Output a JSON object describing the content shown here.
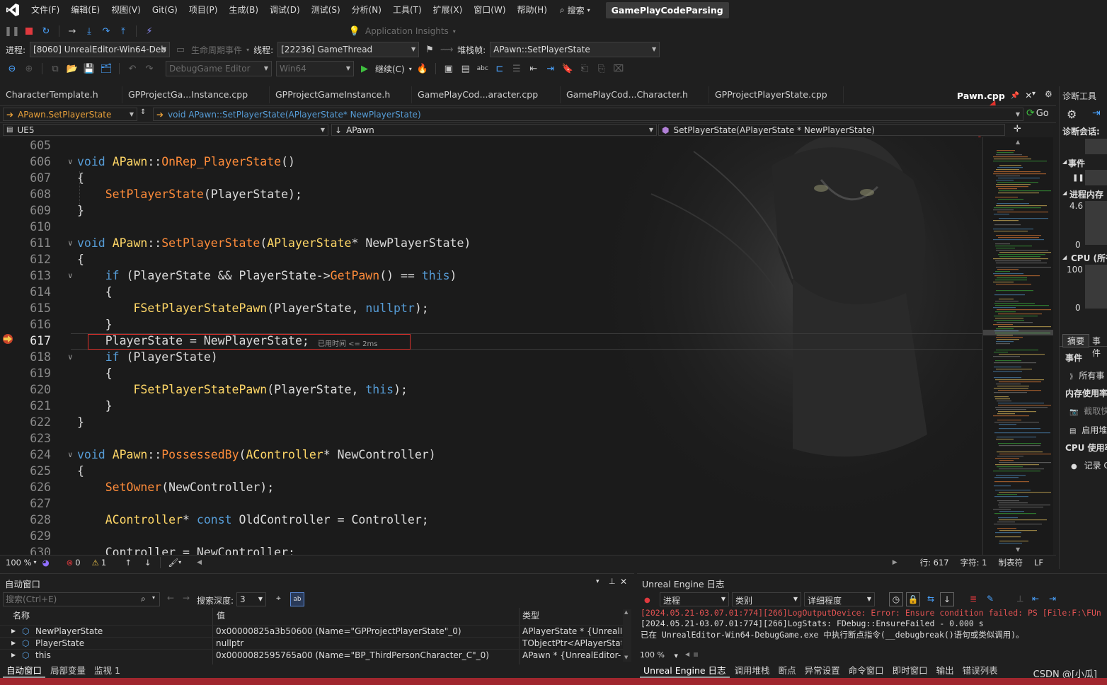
{
  "menu": {
    "items": [
      "文件(F)",
      "编辑(E)",
      "视图(V)",
      "Git(G)",
      "项目(P)",
      "生成(B)",
      "调试(D)",
      "测试(S)",
      "分析(N)",
      "工具(T)",
      "扩展(X)",
      "窗口(W)",
      "帮助(H)"
    ],
    "search_label": "搜索",
    "solution_name": "GamePlayCodeParsing"
  },
  "toolbar": {
    "app_insights": "Application Insights",
    "process_label": "进程:",
    "process_value": "[8060] UnrealEditor-Win64-Deb",
    "lifecycle_label": "生命周期事件",
    "thread_label": "线程:",
    "thread_value": "[22236] GameThread",
    "stackframe_label": "堆栈帧:",
    "stackframe_value": "APawn::SetPlayerState",
    "config_value": "DebugGame Editor",
    "platform_value": "Win64",
    "continue_label": "继续(C)"
  },
  "tabs": {
    "items": [
      "CharacterTemplate.h",
      "GPProjectGa...Instance.cpp",
      "GPProjectGameInstance.h",
      "GamePlayCod...aracter.cpp",
      "GamePlayCod...Character.h",
      "GPProjectPlayerState.cpp"
    ],
    "active": "Pawn.cpp"
  },
  "nav": {
    "member_combo": "APawn.SetPlayerState",
    "signature_combo": "void APawn::SetPlayerState(APlayerState* NewPlayerState)",
    "project_combo": "UE5",
    "class_combo": "APawn",
    "func_combo": "SetPlayerState(APlayerState * NewPlayerState)",
    "go_label": "Go"
  },
  "editor": {
    "lines": [
      {
        "n": "605",
        "html": ""
      },
      {
        "n": "606",
        "html": "<span class='kw'>void</span> <span class='ty'>APawn</span>::<span class='fn'>OnRep_PlayerState</span>()",
        "fold": "∨"
      },
      {
        "n": "607",
        "html": "{"
      },
      {
        "n": "608",
        "html": "    <span class='fn'>SetPlayerState</span>(PlayerState);"
      },
      {
        "n": "609",
        "html": "}"
      },
      {
        "n": "610",
        "html": ""
      },
      {
        "n": "611",
        "html": "<span class='kw'>void</span> <span class='ty'>APawn</span>::<span class='fn'>SetPlayerState</span>(<span class='ty'>APlayerState</span>* NewPlayerState)",
        "fold": "∨"
      },
      {
        "n": "612",
        "html": "{"
      },
      {
        "n": "613",
        "html": "    <span class='kw'>if</span> (PlayerState &amp;&amp; PlayerState-&gt;<span class='fn'>GetPawn</span>() == <span class='kw'>this</span>)",
        "fold": "∨"
      },
      {
        "n": "614",
        "html": "    {"
      },
      {
        "n": "615",
        "html": "        <span class='ty'>FSetPlayerStatePawn</span>(PlayerState, <span class='kw'>nullptr</span>);"
      },
      {
        "n": "616",
        "html": "    }"
      },
      {
        "n": "617",
        "html": "    PlayerState = NewPlayerState;",
        "current": true
      },
      {
        "n": "618",
        "html": "    <span class='kw'>if</span> (PlayerState)",
        "fold": "∨"
      },
      {
        "n": "619",
        "html": "    {"
      },
      {
        "n": "620",
        "html": "        <span class='ty'>FSetPlayerStatePawn</span>(PlayerState, <span class='kw'>this</span>);"
      },
      {
        "n": "621",
        "html": "    }"
      },
      {
        "n": "622",
        "html": "}"
      },
      {
        "n": "623",
        "html": ""
      },
      {
        "n": "624",
        "html": "<span class='kw'>void</span> <span class='ty'>APawn</span>::<span class='fn'>PossessedBy</span>(<span class='ty'>AController</span>* NewController)",
        "fold": "∨"
      },
      {
        "n": "625",
        "html": "{"
      },
      {
        "n": "626",
        "html": "    <span class='fn'>SetOwner</span>(NewController);"
      },
      {
        "n": "627",
        "html": ""
      },
      {
        "n": "628",
        "html": "    <span class='ty'>AController</span>* <span class='kw'>const</span> OldController = Controller;"
      },
      {
        "n": "629",
        "html": ""
      },
      {
        "n": "630",
        "html": "    Controller = NewController;"
      }
    ],
    "perf_tip": "已用时间 <= 2ms"
  },
  "editor_status": {
    "zoom": "100 %",
    "errors": "0",
    "warnings": "1",
    "line": "行: 617",
    "col": "字符: 1",
    "tabs": "制表符",
    "eol": "LF"
  },
  "diag": {
    "title": "诊断工具",
    "session": "诊断会话:",
    "events": "事件",
    "process_mem": "进程内存",
    "mem_max": "4.6",
    "mem_min": "0",
    "cpu": "CPU (所有",
    "cpu_max": "100",
    "cpu_min": "0",
    "tab_summary": "摘要",
    "tab_events": "事件",
    "events_head": "事件",
    "all_events": "所有事",
    "mem_usage": "内存使用率",
    "snapshot": "截取快",
    "enable": "启用堆",
    "cpu_usage": "CPU 使用率",
    "record": "记录 C"
  },
  "auto_window": {
    "title": "自动窗口",
    "search_placeholder": "搜索(Ctrl+E)",
    "depth_label": "搜索深度:",
    "depth_value": "3",
    "col_name": "名称",
    "col_value": "值",
    "col_type": "类型",
    "rows": [
      {
        "name": "NewPlayerState",
        "value": "0x00000825a3b50600 (Name=\"GPProjectPlayerState\"_0)",
        "type": "APlayerState * {UnrealEd..."
      },
      {
        "name": "PlayerState",
        "value": "nullptr",
        "type": "TObjectPtr<APlayerState>"
      },
      {
        "name": "this",
        "value": "0x0000082595765a00 (Name=\"BP_ThirdPersonCharacter_C\"_0)",
        "type": "APawn * {UnrealEditor-G..."
      }
    ],
    "tabs": [
      "自动窗口",
      "局部变量",
      "监视 1"
    ]
  },
  "ue_log": {
    "title": "Unreal Engine 日志",
    "filter_process": "进程",
    "filter_category": "类别",
    "filter_verbosity": "详细程度",
    "lines": [
      {
        "text": "[2024.05.21-03.07.01:774][266]LogOutputDevice: Error: Ensure condition failed: PS [File:F:\\FUn",
        "color": "#e05252"
      },
      {
        "text": "[2024.05.21-03.07.01:774][266]LogStats:             FDebug::EnsureFailed -  0.000 s",
        "color": "#dcdcdc"
      },
      {
        "text": "已在 UnrealEditor-Win64-DebugGame.exe 中执行断点指令(__debugbreak()语句或类似调用)。",
        "color": "#dcdcdc"
      }
    ],
    "zoom": "100 %",
    "tabs": [
      "Unreal Engine 日志",
      "调用堆栈",
      "断点",
      "异常设置",
      "命令窗口",
      "即时窗口",
      "输出",
      "错误列表"
    ]
  },
  "watermark": "CSDN @[小瓜]"
}
